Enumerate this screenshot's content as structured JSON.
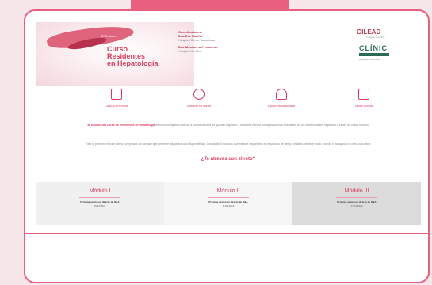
{
  "header": {
    "edition": "3ª Edición",
    "course_title_line1": "Curso",
    "course_title_line2": "Residentes",
    "course_title_line3": "en Hepatología",
    "coordinators_heading": "Coordinadores:",
    "coord1_name": "Dra. Zoe Mariño.",
    "coord1_affil": "Hospital Clínic, Barcelona",
    "coord2_name": "Dra. Montserrat? Lanzmín.",
    "coord2_affil": "Hospital del Mar"
  },
  "sponsors": {
    "gilead": "GILEAD",
    "gilead_sub": "Creating Possible",
    "clinic": "CLÍNIC",
    "clinic_bar": "BARCELONA",
    "clinic_sub": "Hospital Universitari"
  },
  "icons": [
    {
      "label": "Curso 100% online",
      "icon": "monitor-icon"
    },
    {
      "label": "Sesiones en directo",
      "icon": "network-icon"
    },
    {
      "label": "Equipo multidisciplinar",
      "icon": "team-icon"
    },
    {
      "label": "Casos clínicos",
      "icon": "clipboard-icon"
    }
  ],
  "intro": {
    "p1_bold": "3a Edición del Curso de Residentes en Hepatología",
    "p1_rest": " tiene como objetivo acercar a los Residentes de Aparato Digestivo y Medicina Interna los aspectos más relevantes de las enfermedades hepáticas a través de casos clínicos.",
    "p2": "Para la presente edición hemos preparado un formato que pretende adaptarse a tu disponibilidad. Consta de 3 módulos que estarán disponibles en el periodo de tiempo limitado, de este modo, podrás ir trabajando el curso a tu ritmo."
  },
  "cta": "¿Te atreves con el reto?",
  "modules": [
    {
      "title": "Módulo I",
      "next": "Próxima sesión en directo de Q&A",
      "date": "15/10/2021"
    },
    {
      "title": "Módulo II",
      "next": "Próxima sesión en directo de Q&A",
      "date": "11/01/2022"
    },
    {
      "title": "Módulo III",
      "next": "Próxima sesión en directo de Q&A",
      "date": "17/03/2022"
    }
  ]
}
